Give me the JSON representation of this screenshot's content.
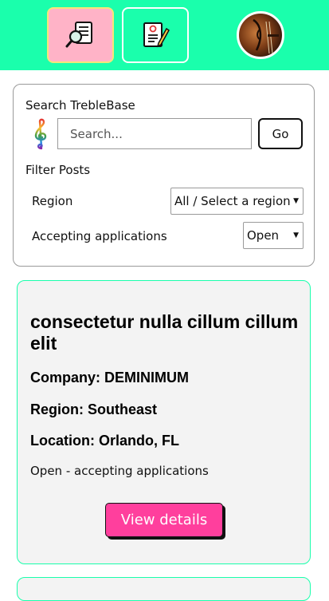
{
  "nav": {
    "search_icon": "magnifier-over-list-icon",
    "apply_icon": "resume-pencil-icon",
    "avatar_icon": "violin-avatar"
  },
  "search": {
    "title": "Search TrebleBase",
    "placeholder": "Search...",
    "go_label": "Go",
    "logo_icon": "treble-clef-icon"
  },
  "filters": {
    "title": "Filter Posts",
    "region_label": "Region",
    "region_value": "All / Select a region",
    "accepting_label": "Accepting applications",
    "accepting_value": "Open"
  },
  "post": {
    "title": "consectetur nulla cillum cillum elit",
    "company": "Company: DEMINIMUM",
    "region": "Region: Southeast",
    "location": "Location: Orlando, FL",
    "status": "Open - accepting applications",
    "view_label": "View details"
  },
  "colors": {
    "topbar": "#1affac",
    "active_nav": "#ffb3c7",
    "cta": "#ff3f9d",
    "card_border": "#1affac"
  }
}
